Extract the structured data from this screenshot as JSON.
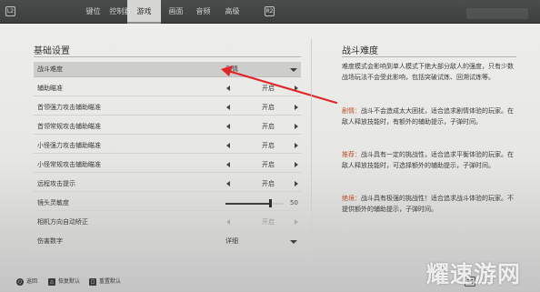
{
  "topbar": {
    "left_key": "L2",
    "right_key": "R2",
    "tabs": [
      {
        "label": "键位",
        "active": false
      },
      {
        "label": "控制器",
        "active": false
      },
      {
        "label": "游戏",
        "active": true
      },
      {
        "label": "画面",
        "active": false
      },
      {
        "label": "音频",
        "active": false
      },
      {
        "label": "高级",
        "active": false
      }
    ]
  },
  "settings": {
    "section_title": "基础设置",
    "rows": [
      {
        "label": "战斗难度",
        "value": "剧情",
        "control": "dropdown",
        "selected": true
      },
      {
        "label": "辅助瞄准",
        "value": "开启",
        "control": "toggle"
      },
      {
        "label": "首领强力攻击辅助瞄准",
        "value": "开启",
        "control": "toggle"
      },
      {
        "label": "首领常规攻击辅助瞄准",
        "value": "开启",
        "control": "toggle"
      },
      {
        "label": "小怪强力攻击辅助瞄准",
        "value": "开启",
        "control": "toggle"
      },
      {
        "label": "小怪常规攻击辅助瞄准",
        "value": "开启",
        "control": "toggle"
      },
      {
        "label": "远程攻击提示",
        "value": "开启",
        "control": "toggle"
      },
      {
        "label": "镜头灵敏度",
        "value": "50",
        "control": "slider",
        "level": 0.78
      },
      {
        "label": "相机方向自动矫正",
        "value": "开启",
        "control": "toggle",
        "disabled": true
      },
      {
        "label": "伤害数字",
        "value": "详细",
        "control": "dropdown"
      }
    ]
  },
  "description": {
    "title": "战斗难度",
    "intro": "难度模式会影响到单人模式下绝大部分敌人的强度，只有少数战场玩法不会受此影响，包括突破试炼、回溯试炼等。",
    "modes": [
      {
        "name": "剧情：",
        "text": "战斗不会造成太大困扰，适合追求剧情体验的玩家。在敌人释放技能时，有额外的辅助提示，子弹时间。"
      },
      {
        "name": "推荐：",
        "text": "战斗具有一定的挑战性，适合追求平衡体验的玩家。在敌人释放技能时，可选择额外的辅助提示，子弹时间。"
      },
      {
        "name": "绝境：",
        "text": "战斗具有极强的挑战性！适合追求战斗体验的玩家。不提供额外的辅助提示，子弹时间。"
      }
    ]
  },
  "bottom": {
    "hints": [
      {
        "key": "○",
        "label": "返回"
      },
      {
        "key": "△",
        "label": "恢复默认"
      },
      {
        "key": "□",
        "label": "重置默认"
      }
    ]
  },
  "watermark": "耀速游网",
  "colors": {
    "accent_red": "#e0252b",
    "mode_name": "#b8512f",
    "topbar": "#3d3f3f"
  }
}
